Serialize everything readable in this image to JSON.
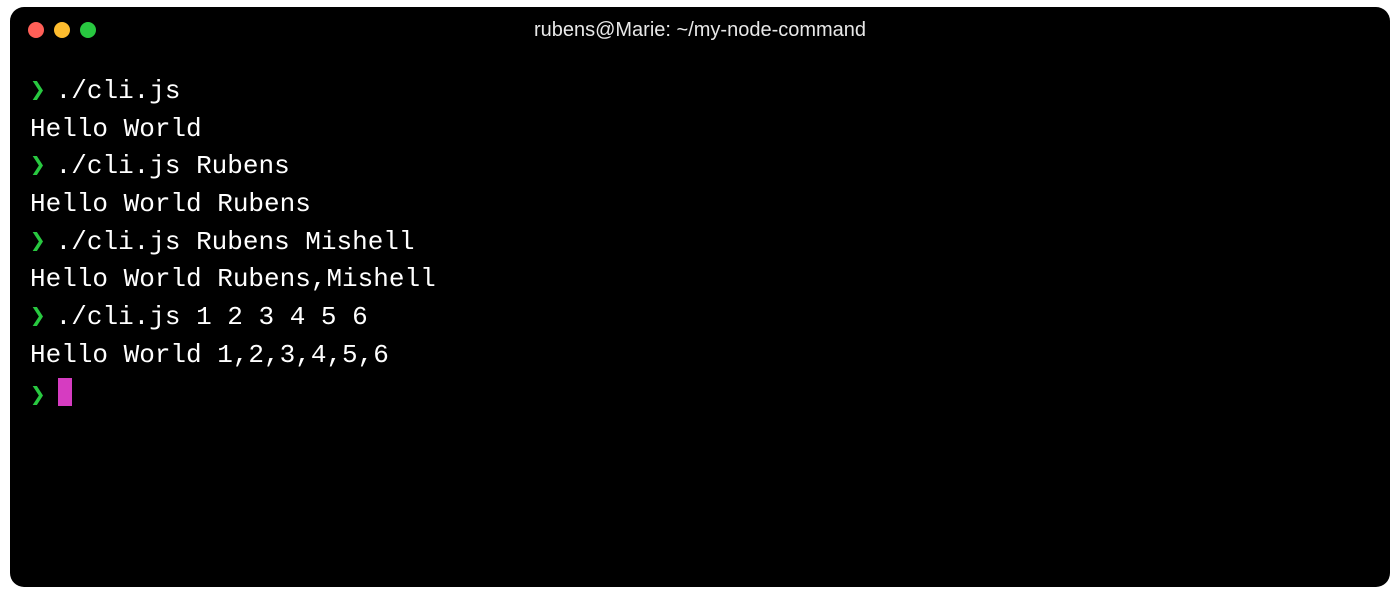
{
  "window": {
    "title": "rubens@Marie: ~/my-node-command"
  },
  "prompt_symbol": "❯",
  "session": [
    {
      "type": "cmd",
      "text": "./cli.js"
    },
    {
      "type": "out",
      "text": "Hello World"
    },
    {
      "type": "cmd",
      "text": "./cli.js Rubens"
    },
    {
      "type": "out",
      "text": "Hello World Rubens"
    },
    {
      "type": "cmd",
      "text": "./cli.js Rubens Mishell"
    },
    {
      "type": "out",
      "text": "Hello World Rubens,Mishell"
    },
    {
      "type": "cmd",
      "text": "./cli.js 1 2 3 4 5 6"
    },
    {
      "type": "out",
      "text": "Hello World 1,2,3,4,5,6"
    },
    {
      "type": "prompt",
      "text": ""
    }
  ],
  "colors": {
    "prompt": "#28c840",
    "cursor": "#d63cc1",
    "close": "#ff5f57",
    "minimize": "#febc2e",
    "maximize": "#28c840"
  }
}
